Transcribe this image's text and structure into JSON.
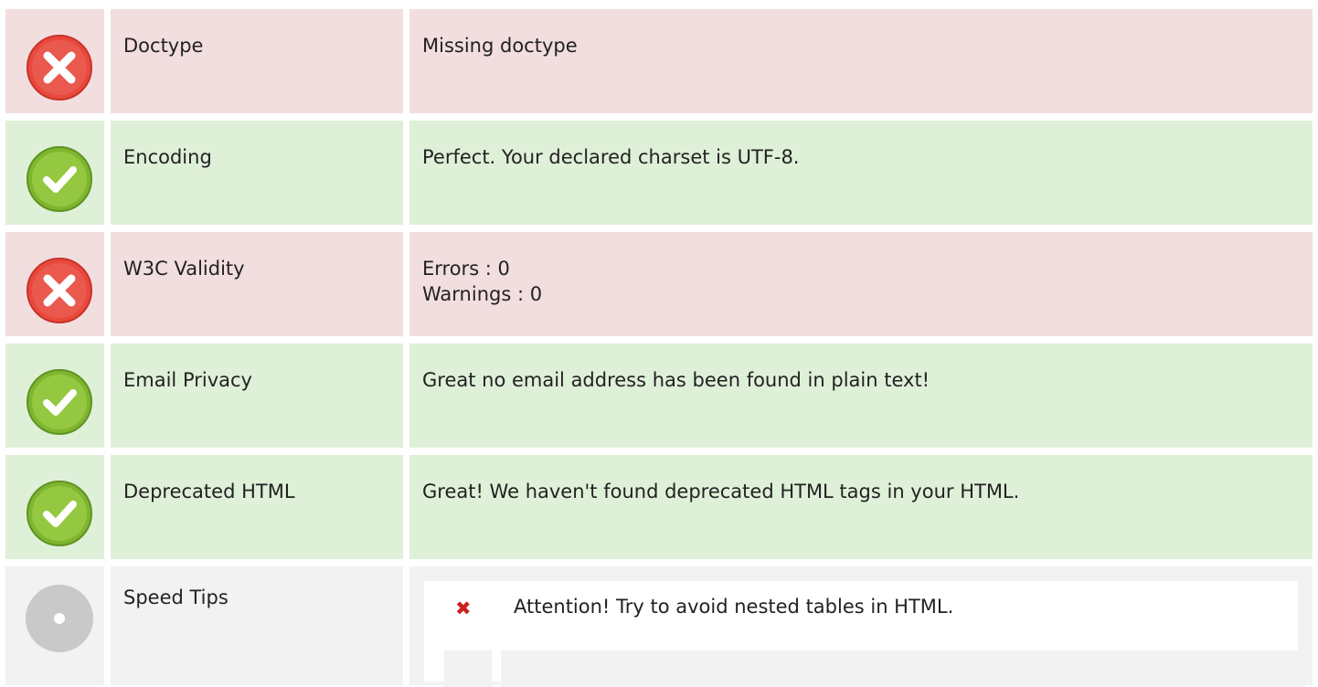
{
  "rows": [
    {
      "status": "error",
      "icon": "error-x-icon",
      "label": "Doctype",
      "value": [
        "Missing doctype"
      ]
    },
    {
      "status": "ok",
      "icon": "check-icon",
      "label": "Encoding",
      "value": [
        "Perfect. Your declared charset is UTF-8."
      ]
    },
    {
      "status": "error",
      "icon": "error-x-icon",
      "label": "W3C Validity",
      "value": [
        "Errors : 0",
        "Warnings : 0"
      ]
    },
    {
      "status": "ok",
      "icon": "check-icon",
      "label": "Email Privacy",
      "value": [
        "Great no email address has been found in plain text!"
      ]
    },
    {
      "status": "ok",
      "icon": "check-icon",
      "label": "Deprecated HTML",
      "value": [
        "Great! We haven't found deprecated HTML tags in your HTML."
      ]
    },
    {
      "status": "neutral",
      "icon": "neutral-dot-icon",
      "label": "Speed Tips",
      "tips": [
        {
          "icon": "cross-mark-icon",
          "glyph": "✖",
          "text": "Attention! Try to avoid nested tables in HTML."
        }
      ]
    }
  ],
  "colors": {
    "error_bg": "#f2dedf",
    "ok_bg": "#dff0d8",
    "neutral_bg": "#f2f2f2",
    "error_icon": "#e04a3f",
    "ok_icon": "#8cc63f",
    "neutral_icon": "#c8c8c8",
    "tip_mark": "#cc1f1f"
  }
}
